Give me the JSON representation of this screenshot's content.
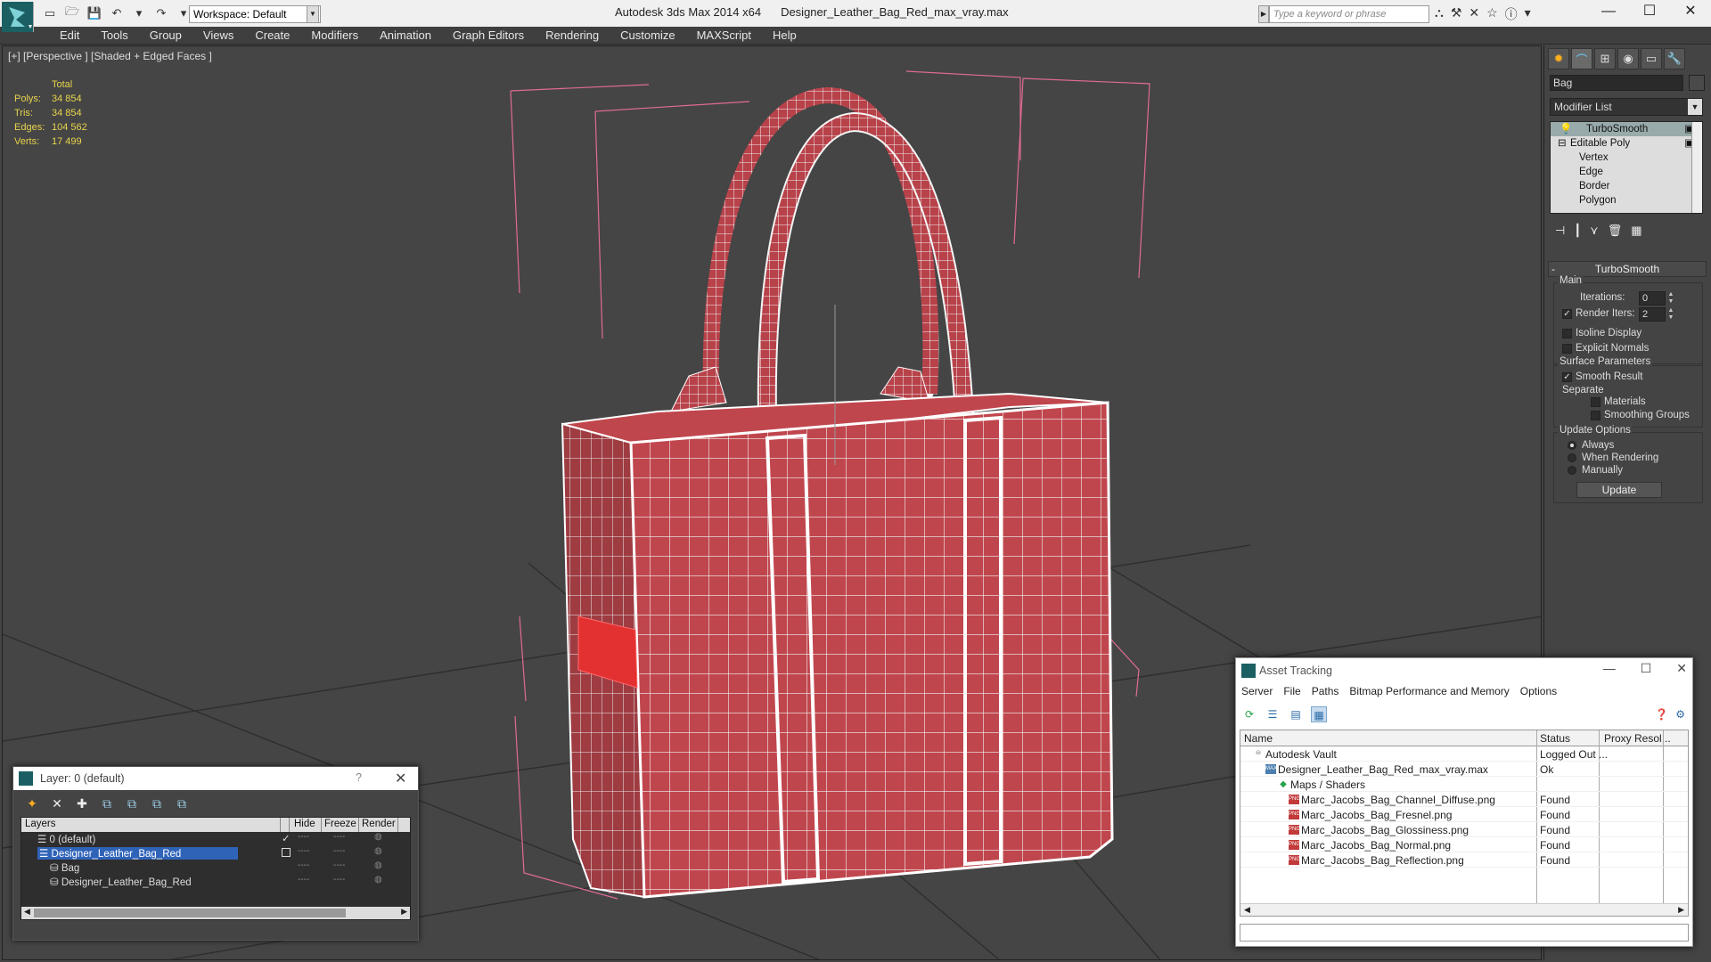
{
  "titlebar": {
    "app": "Autodesk 3ds Max  2014 x64",
    "file": "Designer_Leather_Bag_Red_max_vray.max",
    "workspace": "Workspace: Default",
    "search_placeholder": "Type a keyword or phrase",
    "controls": [
      "—",
      "☐",
      "✕"
    ]
  },
  "menu": [
    "Edit",
    "Tools",
    "Group",
    "Views",
    "Create",
    "Modifiers",
    "Animation",
    "Graph Editors",
    "Rendering",
    "Customize",
    "MAXScript",
    "Help"
  ],
  "viewport": {
    "label": "[+] [Perspective ] [Shaded + Edged Faces ]",
    "stats": {
      "header": "Total",
      "rows": [
        {
          "k": "Polys:",
          "v": "34 854"
        },
        {
          "k": "Tris:",
          "v": "34 854"
        },
        {
          "k": "Edges:",
          "v": "104 562"
        },
        {
          "k": "Verts:",
          "v": "17 499"
        }
      ]
    }
  },
  "command_panel": {
    "object_name": "Bag",
    "modifier_list": "Modifier List",
    "stack": [
      "TurboSmooth",
      "Editable Poly",
      "Vertex",
      "Edge",
      "Border",
      "Polygon"
    ],
    "rollout_title": "TurboSmooth",
    "main_group": "Main",
    "iterations_label": "Iterations:",
    "iterations_value": "0",
    "render_iters_label": "Render Iters:",
    "render_iters_value": "2",
    "isoline": "Isoline Display",
    "explicit_normals": "Explicit Normals",
    "surface_group": "Surface Parameters",
    "smooth_result": "Smooth Result",
    "separate": "Separate",
    "materials": "Materials",
    "smoothing_groups": "Smoothing Groups",
    "update_group": "Update Options",
    "always": "Always",
    "when_rendering": "When Rendering",
    "manually": "Manually",
    "update_button": "Update"
  },
  "layer_dialog": {
    "title": "Layer: 0 (default)",
    "help": "?",
    "close": "✕",
    "columns": [
      "Layers",
      "Hide",
      "Freeze",
      "Render"
    ],
    "rows": [
      {
        "name": "0 (default)",
        "indent": 1,
        "selected": false
      },
      {
        "name": "Designer_Leather_Bag_Red",
        "indent": 1,
        "selected": true
      },
      {
        "name": "Bag",
        "indent": 2,
        "selected": false
      },
      {
        "name": "Designer_Leather_Bag_Red",
        "indent": 2,
        "selected": false
      }
    ]
  },
  "asset_tracking": {
    "title": "Asset Tracking",
    "menu": [
      "Server",
      "File",
      "Paths",
      "Bitmap Performance and Memory",
      "Options"
    ],
    "columns": [
      "Name",
      "Status",
      "Proxy Resol..."
    ],
    "rows": [
      {
        "name": "Autodesk Vault",
        "status": "Logged Out ...",
        "indent": 0,
        "icon": "vault"
      },
      {
        "name": "Designer_Leather_Bag_Red_max_vray.max",
        "status": "Ok",
        "indent": 1,
        "icon": "max"
      },
      {
        "name": "Maps / Shaders",
        "status": "",
        "indent": 2,
        "icon": "folder"
      },
      {
        "name": "Marc_Jacobs_Bag_Channel_Diffuse.png",
        "status": "Found",
        "indent": 3,
        "icon": "png"
      },
      {
        "name": "Marc_Jacobs_Bag_Fresnel.png",
        "status": "Found",
        "indent": 3,
        "icon": "png"
      },
      {
        "name": "Marc_Jacobs_Bag_Glossiness.png",
        "status": "Found",
        "indent": 3,
        "icon": "png"
      },
      {
        "name": "Marc_Jacobs_Bag_Normal.png",
        "status": "Found",
        "indent": 3,
        "icon": "png"
      },
      {
        "name": "Marc_Jacobs_Bag_Reflection.png",
        "status": "Found",
        "indent": 3,
        "icon": "png"
      }
    ]
  }
}
